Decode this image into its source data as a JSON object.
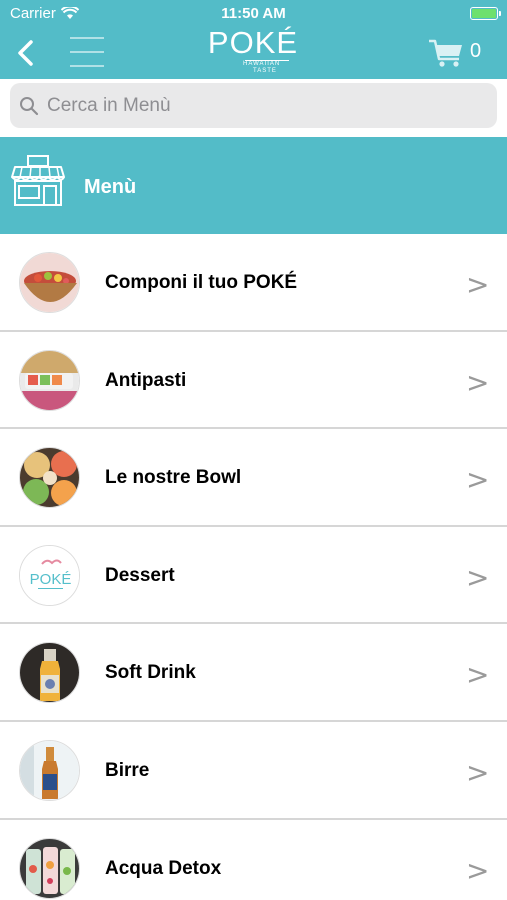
{
  "status_bar": {
    "carrier": "Carrier",
    "time": "11:50 AM"
  },
  "header": {
    "logo_main": "POKÉ",
    "logo_sub_1": "HAWAIIAN",
    "logo_sub_2": "TASTE",
    "cart_count": "0"
  },
  "search": {
    "placeholder": "Cerca in Menù"
  },
  "banner": {
    "title": "Menù"
  },
  "menu": {
    "items": [
      {
        "label": "Componi il tuo POKÉ"
      },
      {
        "label": "Antipasti"
      },
      {
        "label": "Le nostre Bowl"
      },
      {
        "label": "Dessert"
      },
      {
        "label": "Soft Drink"
      },
      {
        "label": "Birre"
      },
      {
        "label": "Acqua Detox"
      }
    ]
  },
  "chevron_glyph": ">",
  "colors": {
    "accent": "#53bcc8",
    "search_bg": "#e9e9ea",
    "divider": "#d6d6d6"
  }
}
